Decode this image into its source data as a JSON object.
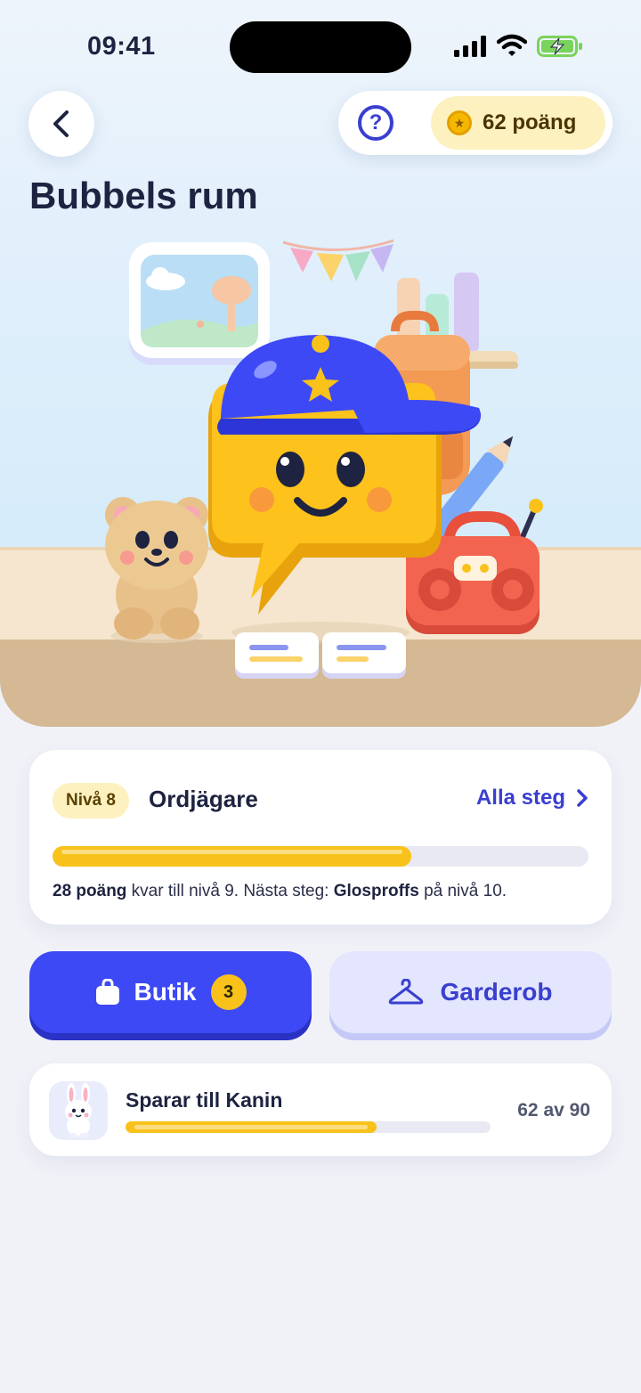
{
  "status": {
    "time": "09:41"
  },
  "header": {
    "title": "Bubbels rum",
    "points_label": "62 poäng"
  },
  "level": {
    "badge": "Nivå 8",
    "name": "Ordjägare",
    "all_steps_label": "Alla steg",
    "progress": 0.67,
    "desc_points": "28 poäng",
    "desc_mid": " kvar till nivå 9. Nästa steg: ",
    "desc_next": "Glosproffs",
    "desc_end": " på nivå 10."
  },
  "actions": {
    "shop_label": "Butik",
    "shop_count": "3",
    "wardrobe_label": "Garderob"
  },
  "saving": {
    "title": "Sparar till Kanin",
    "count": "62 av 90",
    "progress": 0.689
  },
  "colors": {
    "primary": "#3d49f5",
    "accent_yellow": "#f8c21b",
    "text_dark": "#1d2340"
  }
}
